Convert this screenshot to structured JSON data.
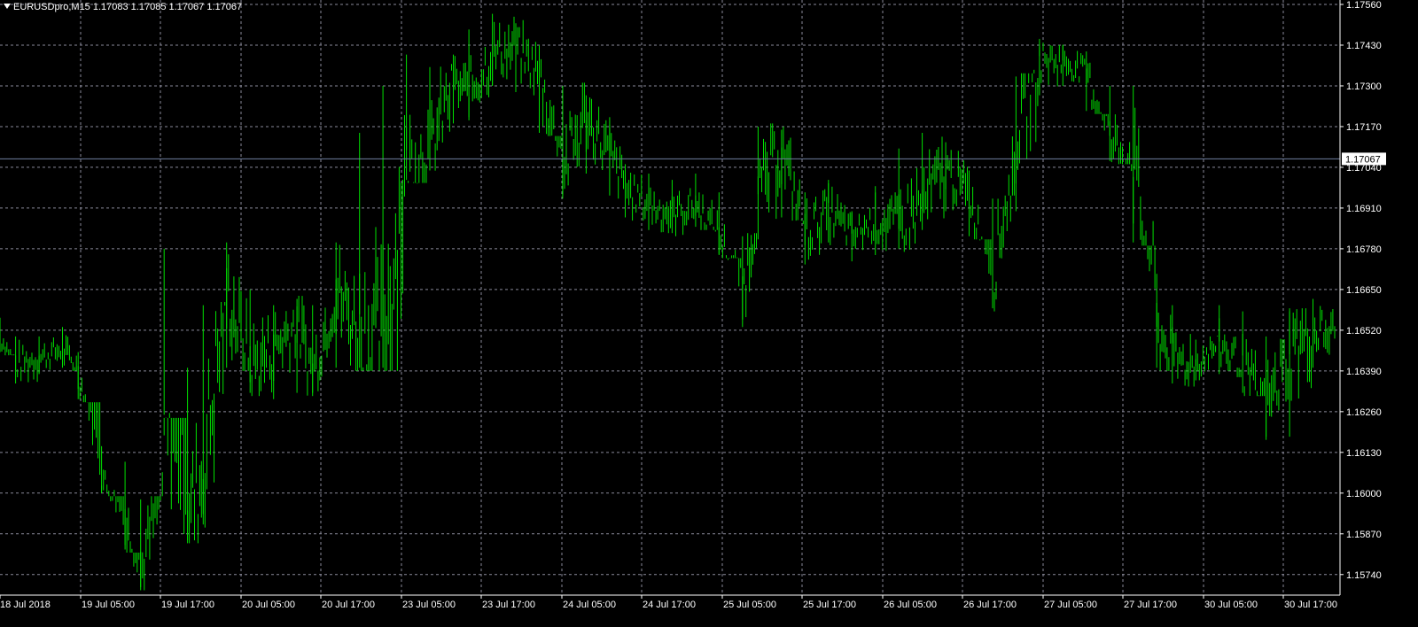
{
  "header": {
    "arrow_icon": "triangle-down-icon",
    "text": "EURUSDpro,M15  1.17083 1.17085 1.17067 1.17067"
  },
  "colors": {
    "background": "#000000",
    "grid": "#8a8a9a",
    "bars": "#00e000",
    "axis_text": "#ffffff",
    "bid_line": "#6f7f9f",
    "price_label_bg": "#ffffff",
    "price_label_text": "#000000"
  },
  "chart_data": {
    "type": "line",
    "symbol": "EURUSDpro",
    "timeframe": "M15",
    "title": "",
    "grid": true,
    "ylim": [
      1.1568,
      1.1756
    ],
    "y_ticks": [
      "1.17560",
      "1.17430",
      "1.17300",
      "1.17170",
      "1.17040",
      "1.16910",
      "1.16780",
      "1.16650",
      "1.16520",
      "1.16390",
      "1.16260",
      "1.16130",
      "1.16000",
      "1.15870",
      "1.15740"
    ],
    "x_ticks": [
      "18 Jul 2018",
      "19 Jul 05:00",
      "19 Jul 17:00",
      "20 Jul 05:00",
      "20 Jul 17:00",
      "23 Jul 05:00",
      "23 Jul 17:00",
      "24 Jul 05:00",
      "24 Jul 17:00",
      "25 Jul 05:00",
      "25 Jul 17:00",
      "26 Jul 05:00",
      "26 Jul 17:00",
      "27 Jul 05:00",
      "27 Jul 17:00",
      "30 Jul 05:00",
      "30 Jul 17:00"
    ],
    "current_price": "1.17067",
    "series": [
      {
        "kind": "bars",
        "x_index": [
          0,
          2,
          5,
          8,
          10,
          13,
          16,
          18,
          21,
          24,
          26,
          29,
          32,
          35,
          38,
          40,
          43,
          46,
          49,
          52,
          55,
          58,
          60,
          63,
          66,
          69,
          72,
          75,
          78,
          80,
          83,
          86,
          89,
          92,
          95,
          97,
          100,
          103,
          106,
          109,
          112,
          115,
          118,
          121,
          124,
          127,
          130,
          133,
          136,
          139,
          142,
          145,
          148,
          150,
          153,
          156,
          159,
          162,
          165,
          168,
          171
        ],
        "close": [
          1.165,
          1.1641,
          1.1643,
          1.1646,
          1.1639,
          1.1605,
          1.159,
          1.1574,
          1.1606,
          1.1592,
          1.1606,
          1.1665,
          1.164,
          1.1646,
          1.1655,
          1.1638,
          1.1664,
          1.1652,
          1.1646,
          1.1705,
          1.171,
          1.173,
          1.1728,
          1.174,
          1.1742,
          1.1734,
          1.1704,
          1.172,
          1.1708,
          1.1697,
          1.1692,
          1.1689,
          1.1692,
          1.1682,
          1.1663,
          1.1694,
          1.171,
          1.1683,
          1.169,
          1.1682,
          1.1687,
          1.1686,
          1.1692,
          1.1703,
          1.1695,
          1.1667,
          1.1715,
          1.1738,
          1.1738,
          1.1734,
          1.1712,
          1.1705,
          1.1652,
          1.1643,
          1.1641,
          1.1648,
          1.164,
          1.1626,
          1.1645,
          1.1652,
          1.165
        ],
        "high": [
          1.1656,
          1.165,
          1.165,
          1.1653,
          1.1645,
          1.1615,
          1.161,
          1.1598,
          1.1678,
          1.164,
          1.166,
          1.168,
          1.1665,
          1.166,
          1.1662,
          1.166,
          1.168,
          1.1715,
          1.173,
          1.174,
          1.1736,
          1.174,
          1.1748,
          1.1753,
          1.175,
          1.1743,
          1.173,
          1.1727,
          1.172,
          1.1705,
          1.1702,
          1.17,
          1.1702,
          1.1696,
          1.1682,
          1.1717,
          1.1716,
          1.1696,
          1.17,
          1.169,
          1.1698,
          1.171,
          1.1715,
          1.1712,
          1.1703,
          1.1694,
          1.1733,
          1.1745,
          1.1743,
          1.1741,
          1.173,
          1.173,
          1.167,
          1.166,
          1.1649,
          1.166,
          1.1658,
          1.165,
          1.1658,
          1.1662,
          1.166
        ],
        "low": [
          1.1645,
          1.1635,
          1.1638,
          1.164,
          1.163,
          1.16,
          1.1582,
          1.157,
          1.1625,
          1.1585,
          1.159,
          1.164,
          1.1632,
          1.163,
          1.1632,
          1.1632,
          1.164,
          1.164,
          1.164,
          1.17,
          1.1703,
          1.1718,
          1.172,
          1.173,
          1.1728,
          1.1715,
          1.1695,
          1.1702,
          1.1695,
          1.1688,
          1.1684,
          1.1683,
          1.1685,
          1.1676,
          1.1653,
          1.1681,
          1.1688,
          1.1673,
          1.168,
          1.1674,
          1.1676,
          1.1678,
          1.1684,
          1.169,
          1.1682,
          1.1659,
          1.169,
          1.1727,
          1.173,
          1.1722,
          1.1706,
          1.168,
          1.164,
          1.1635,
          1.1636,
          1.1638,
          1.1632,
          1.1618,
          1.1618,
          1.164,
          1.1642
        ]
      }
    ]
  }
}
